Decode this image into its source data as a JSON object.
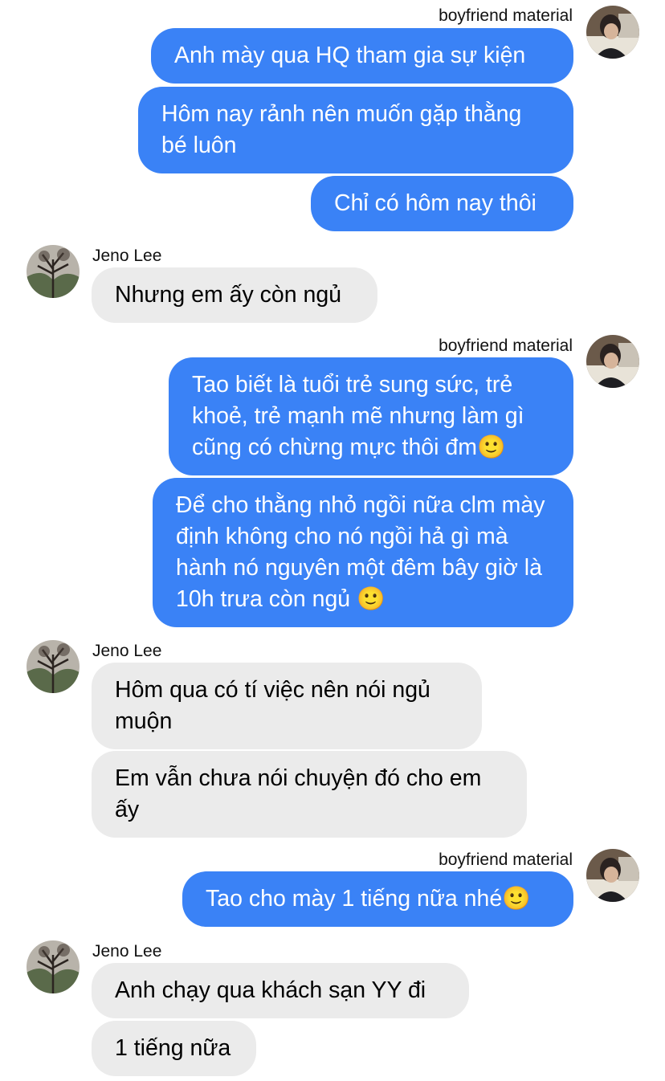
{
  "participants": {
    "self_name": "boyfriend material",
    "other_name": "Jeno Lee"
  },
  "messages": {
    "g1": {
      "sender": "boyfriend material",
      "m1": "Anh mày qua HQ tham gia sự kiện",
      "m2": "Hôm nay rảnh nên muốn gặp thằng bé luôn",
      "m3": "Chỉ có hôm nay thôi"
    },
    "g2": {
      "sender": "Jeno Lee",
      "m1": "Nhưng em ấy còn ngủ"
    },
    "g3": {
      "sender": "boyfriend material",
      "m1": "Tao biết là tuổi trẻ sung sức, trẻ khoẻ, trẻ mạnh mẽ nhưng làm gì cũng có chừng mực thôi đm🙂",
      "m2": "Để cho thằng nhỏ ngồi nữa clm mày định không cho nó ngồi hả gì mà hành nó nguyên một đêm bây giờ là 10h trưa còn ngủ 🙂"
    },
    "g4": {
      "sender": "Jeno Lee",
      "m1": "Hôm qua có tí việc nên nói ngủ muộn",
      "m2": "Em vẫn chưa nói chuyện đó cho em ấy"
    },
    "g5": {
      "sender": "boyfriend material",
      "m1": "Tao cho mày 1 tiếng nữa nhé🙂"
    },
    "g6": {
      "sender": "Jeno Lee",
      "m1": "Anh chạy qua khách sạn YY đi",
      "m2": "1 tiếng nữa"
    }
  },
  "colors": {
    "outgoing_bubble": "#3a82f6",
    "incoming_bubble": "#ebebeb"
  },
  "icons": {
    "self_avatar": "boyfriend-material-avatar",
    "other_avatar": "jeno-lee-avatar"
  }
}
